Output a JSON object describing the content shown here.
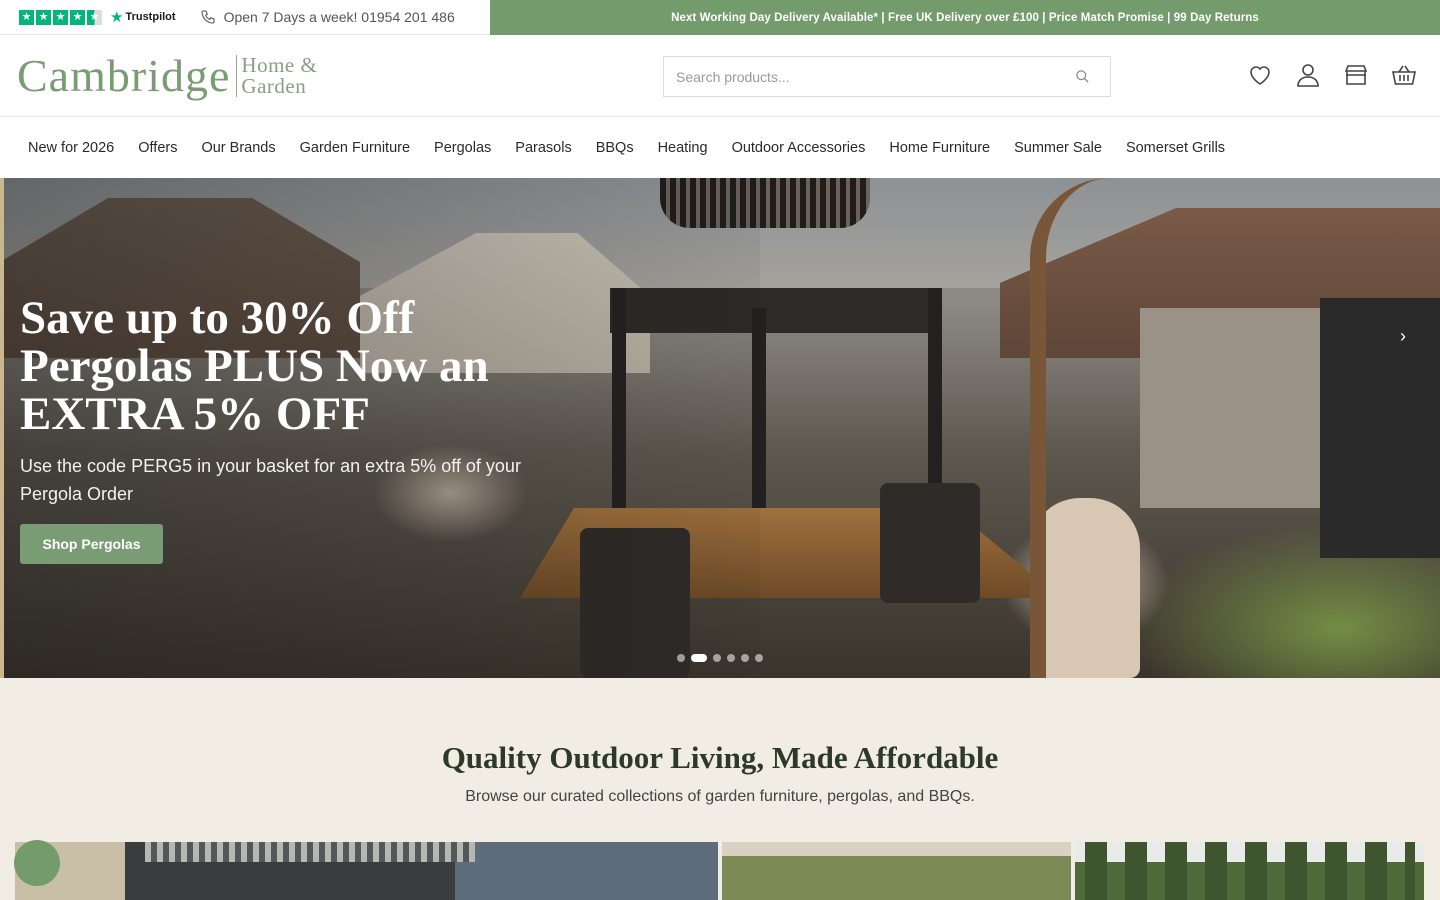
{
  "topbar": {
    "trustpilot": "Trustpilot",
    "phone": "Open 7 Days a week! 01954 201 486",
    "promo": "Next Working Day Delivery Available* | Free UK Delivery over £100 | Price Match Promise | 99 Day Returns",
    "accent": "#739b6c"
  },
  "header": {
    "logo_main": "Cambridge",
    "logo_sub1": "Home &",
    "logo_sub2": "Garden",
    "search_placeholder": "Search products...",
    "icons": [
      "heart-icon",
      "user-icon",
      "store-icon",
      "basket-icon"
    ]
  },
  "nav": {
    "items": [
      {
        "label": "New for 2026"
      },
      {
        "label": "Offers"
      },
      {
        "label": "Our Brands"
      },
      {
        "label": "Garden Furniture"
      },
      {
        "label": "Pergolas"
      },
      {
        "label": "Parasols"
      },
      {
        "label": "BBQs"
      },
      {
        "label": "Heating"
      },
      {
        "label": "Outdoor Accessories"
      },
      {
        "label": "Home Furniture"
      },
      {
        "label": "Summer Sale"
      },
      {
        "label": "Somerset Grills"
      }
    ]
  },
  "hero": {
    "title": "Save up to 30% Off Pergolas PLUS Now an EXTRA 5% OFF",
    "subtitle": "Use the code PERG5 in your basket for an extra 5% off of your Pergola Order",
    "button": "Shop Pergolas",
    "slides": 6,
    "active_slide": 2
  },
  "section": {
    "title": "Quality Outdoor Living, Made Affordable",
    "subtitle": "Browse our curated collections of garden furniture, pergolas, and BBQs."
  }
}
